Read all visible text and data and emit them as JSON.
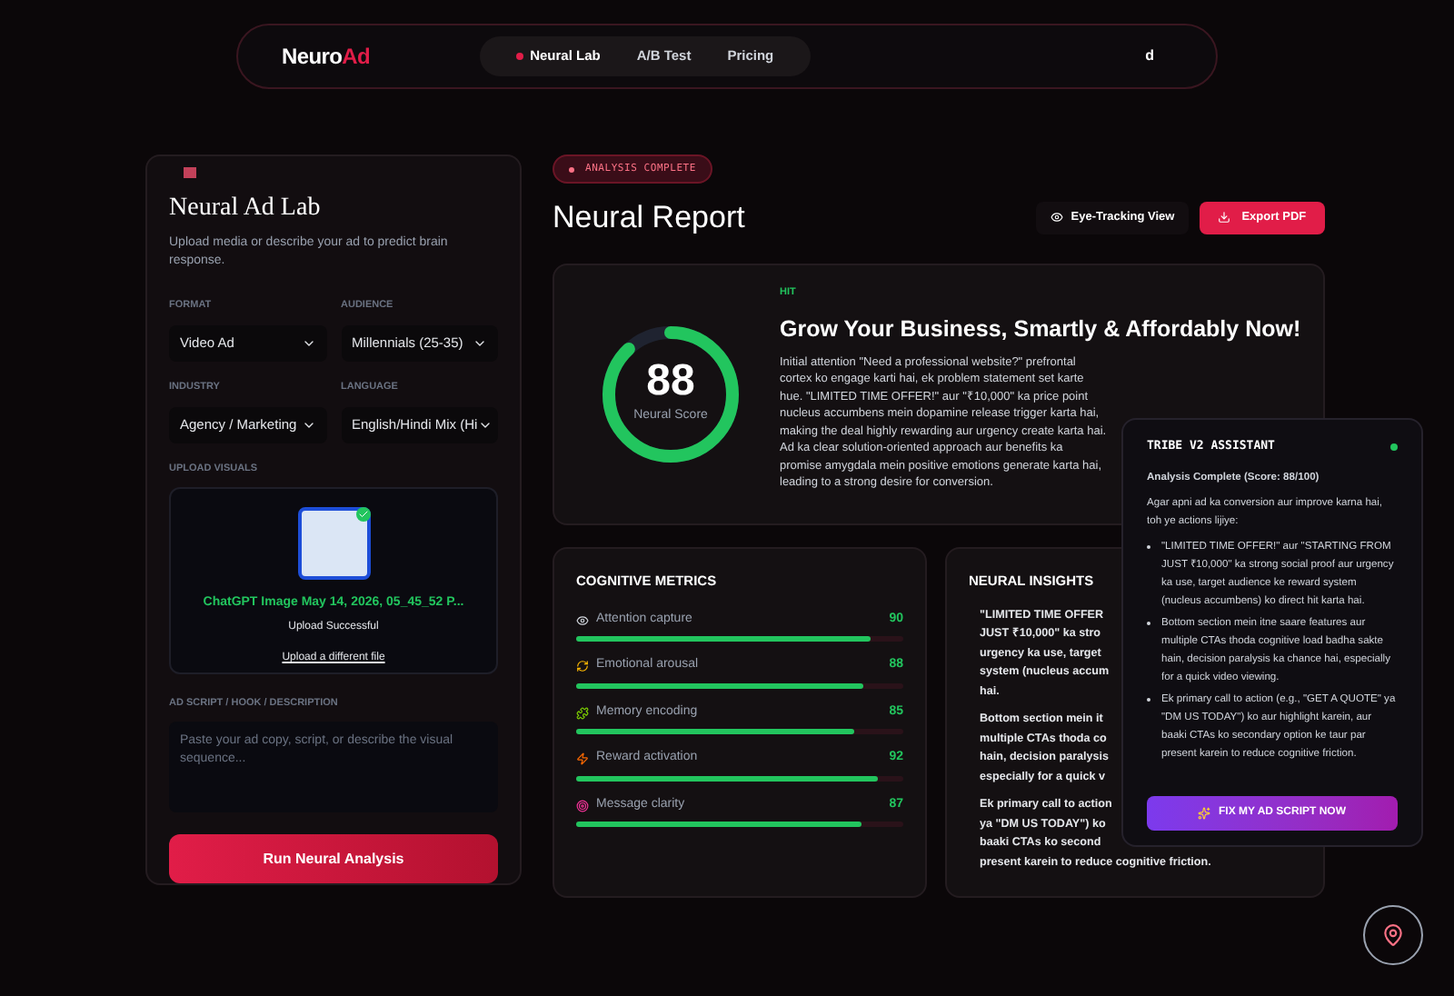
{
  "nav": {
    "logo_a": "Neuro",
    "logo_b": "Ad",
    "links": [
      {
        "label": "Neural Lab",
        "selected": true
      },
      {
        "label": "A/B Test",
        "selected": false
      },
      {
        "label": "Pricing",
        "selected": false
      }
    ],
    "user": "d"
  },
  "lab": {
    "title": "Neural Ad Lab",
    "subtitle": "Upload media or describe your ad to predict brain response.",
    "selects": [
      {
        "label": "FORMAT",
        "value": "Video Ad"
      },
      {
        "label": "AUDIENCE",
        "value": "Millennials (25-35)"
      },
      {
        "label": "INDUSTRY",
        "value": "Agency / Marketing"
      },
      {
        "label": "LANGUAGE",
        "value": "English/Hindi Mix (Hi"
      }
    ],
    "upload": {
      "label": "UPLOAD VISUALS",
      "file": "ChatGPT Image May 14, 2026, 05_45_52 P...",
      "status": "Upload Successful",
      "link": "Upload a different file"
    },
    "script": {
      "label": "AD SCRIPT / HOOK / DESCRIPTION",
      "placeholder": "Paste your ad copy, script, or describe the visual sequence..."
    },
    "button": "Run Neural Analysis"
  },
  "report": {
    "badge": "ANALYSIS COMPLETE",
    "title": "Neural Report",
    "eye_button": "Eye-Tracking View",
    "export_button": "Export PDF",
    "score": {
      "value": "88",
      "label": "Neural Score",
      "level": 0.88
    },
    "verdict": "HIT",
    "headline": "Grow Your Business, Smartly & Affordably Now!",
    "summary": "Initial attention \"Need a professional website?\" prefrontal cortex ko engage karti hai, ek problem statement set karte hue. \"LIMITED TIME OFFER!\" aur \"₹10,000\" ka price point nucleus accumbens mein dopamine release trigger karta hai, making the deal highly rewarding aur urgency create karta hai. Ad ka clear solution-oriented approach aur benefits ka promise amygdala mein positive emotions generate karta hai, leading to a strong desire for conversion."
  },
  "metrics": {
    "title": "COGNITIVE METRICS",
    "items": [
      {
        "label": "Attention capture",
        "value": "90",
        "level": 0.9
      },
      {
        "label": "Emotional arousal",
        "value": "88",
        "level": 0.88
      },
      {
        "label": "Memory encoding",
        "value": "85",
        "level": 0.85
      },
      {
        "label": "Reward activation",
        "value": "92",
        "level": 0.92
      },
      {
        "label": "Message clarity",
        "value": "87",
        "level": 0.87
      }
    ]
  },
  "insights": {
    "title": "NEURAL INSIGHTS",
    "items": [
      {
        "lines": [
          "\"LIMITED TIME OFFER",
          "JUST ₹10,000\" ka stro",
          "urgency ka use, target",
          "system (nucleus accum",
          "hai."
        ]
      },
      {
        "lines": [
          "Bottom section mein it",
          "multiple CTAs thoda co",
          "hain, decision paralysis",
          "especially for a quick v"
        ]
      },
      {
        "lines": [
          "Ek primary call to action",
          "ya \"DM US TODAY\") ko",
          "baaki CTAs ko second",
          "present karein to reduce cognitive friction."
        ]
      }
    ]
  },
  "assistant": {
    "title": "TRIBE V2 ASSISTANT",
    "online": true,
    "status": "Analysis Complete (Score: 88/100)",
    "intro": "Agar apni ad ka conversion aur improve karna hai, toh ye actions lijiye:",
    "items": [
      "\"LIMITED TIME OFFER!\" aur \"STARTING FROM JUST ₹10,000\" ka strong social proof aur urgency ka use, target audience ke reward system (nucleus accumbens) ko direct hit karta hai.",
      "Bottom section mein itne saare features aur multiple CTAs thoda cognitive load badha sakte hain, decision paralysis ka chance hai, especially for a quick video viewing.",
      "Ek primary call to action (e.g., \"GET A QUOTE\" ya \"DM US TODAY\") ko aur highlight karein, aur baaki CTAs ko secondary option ke taur par present karein to reduce cognitive friction."
    ],
    "button": "FIX MY AD SCRIPT NOW"
  }
}
